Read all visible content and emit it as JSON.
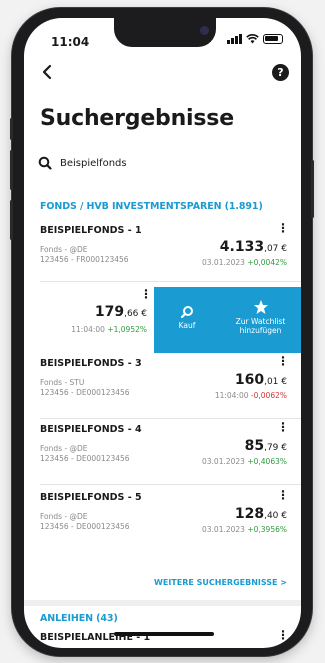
{
  "status_bar": {
    "time": "11:04"
  },
  "header": {
    "help_label": "?"
  },
  "page": {
    "title": "Suchergebnisse"
  },
  "search": {
    "query": "Beispielfonds"
  },
  "funds_section": {
    "heading": "FONDS / HVB INVESTMENTSPAREN (1.891)",
    "rows": [
      {
        "name": "BEISPIELFONDS - 1",
        "meta1": "Fonds - @DE",
        "meta2": "123456 - FR000123456",
        "price_main": "4.133",
        "price_decimals": ",07 €",
        "date": "03.01.2023",
        "change": "+0,0042%",
        "change_positive": true
      },
      {
        "name": "",
        "meta1": "",
        "meta2": "",
        "price_main": "179",
        "price_decimals": ",66 €",
        "date": "11:04:00",
        "change": "+1,0952%",
        "change_positive": true
      },
      {
        "name": "BEISPIELFONDS - 3",
        "meta1": "Fonds - STU",
        "meta2": "123456 - DE000123456",
        "price_main": "160",
        "price_decimals": ",01 €",
        "date": "11:04:00",
        "change": "-0,0062%",
        "change_positive": false
      },
      {
        "name": "BEISPIELFONDS - 4",
        "meta1": "Fonds - @DE",
        "meta2": "123456 - DE000123456",
        "price_main": "85",
        "price_decimals": ",79 €",
        "date": "03.01.2023",
        "change": "+0,4063%",
        "change_positive": true
      },
      {
        "name": "BEISPIELFONDS - 5",
        "meta1": "Fonds - @DE",
        "meta2": "123456 - DE000123456",
        "price_main": "128",
        "price_decimals": ",40 €",
        "date": "03.01.2023",
        "change": "+0,3956%",
        "change_positive": true
      }
    ],
    "swipe_actions": {
      "buy_label": "Kauf",
      "watchlist_label_1": "Zur Watchlist",
      "watchlist_label_2": "hinzufügen"
    },
    "more_label": "WEITERE SUCHERGEBNISSE >"
  },
  "bonds_section": {
    "heading": "ANLEIHEN (43)",
    "first_row_name": "BEISPIELANLEIHE - 1"
  },
  "colors": {
    "accent": "#1a9bd1",
    "positive": "#2e9b3e",
    "negative": "#d6333a"
  },
  "icons": [
    "back-arrow-icon",
    "help-icon",
    "search-icon",
    "more-vertical-icon",
    "buy-icon",
    "star-icon",
    "signal-icon",
    "wifi-icon",
    "battery-icon"
  ]
}
